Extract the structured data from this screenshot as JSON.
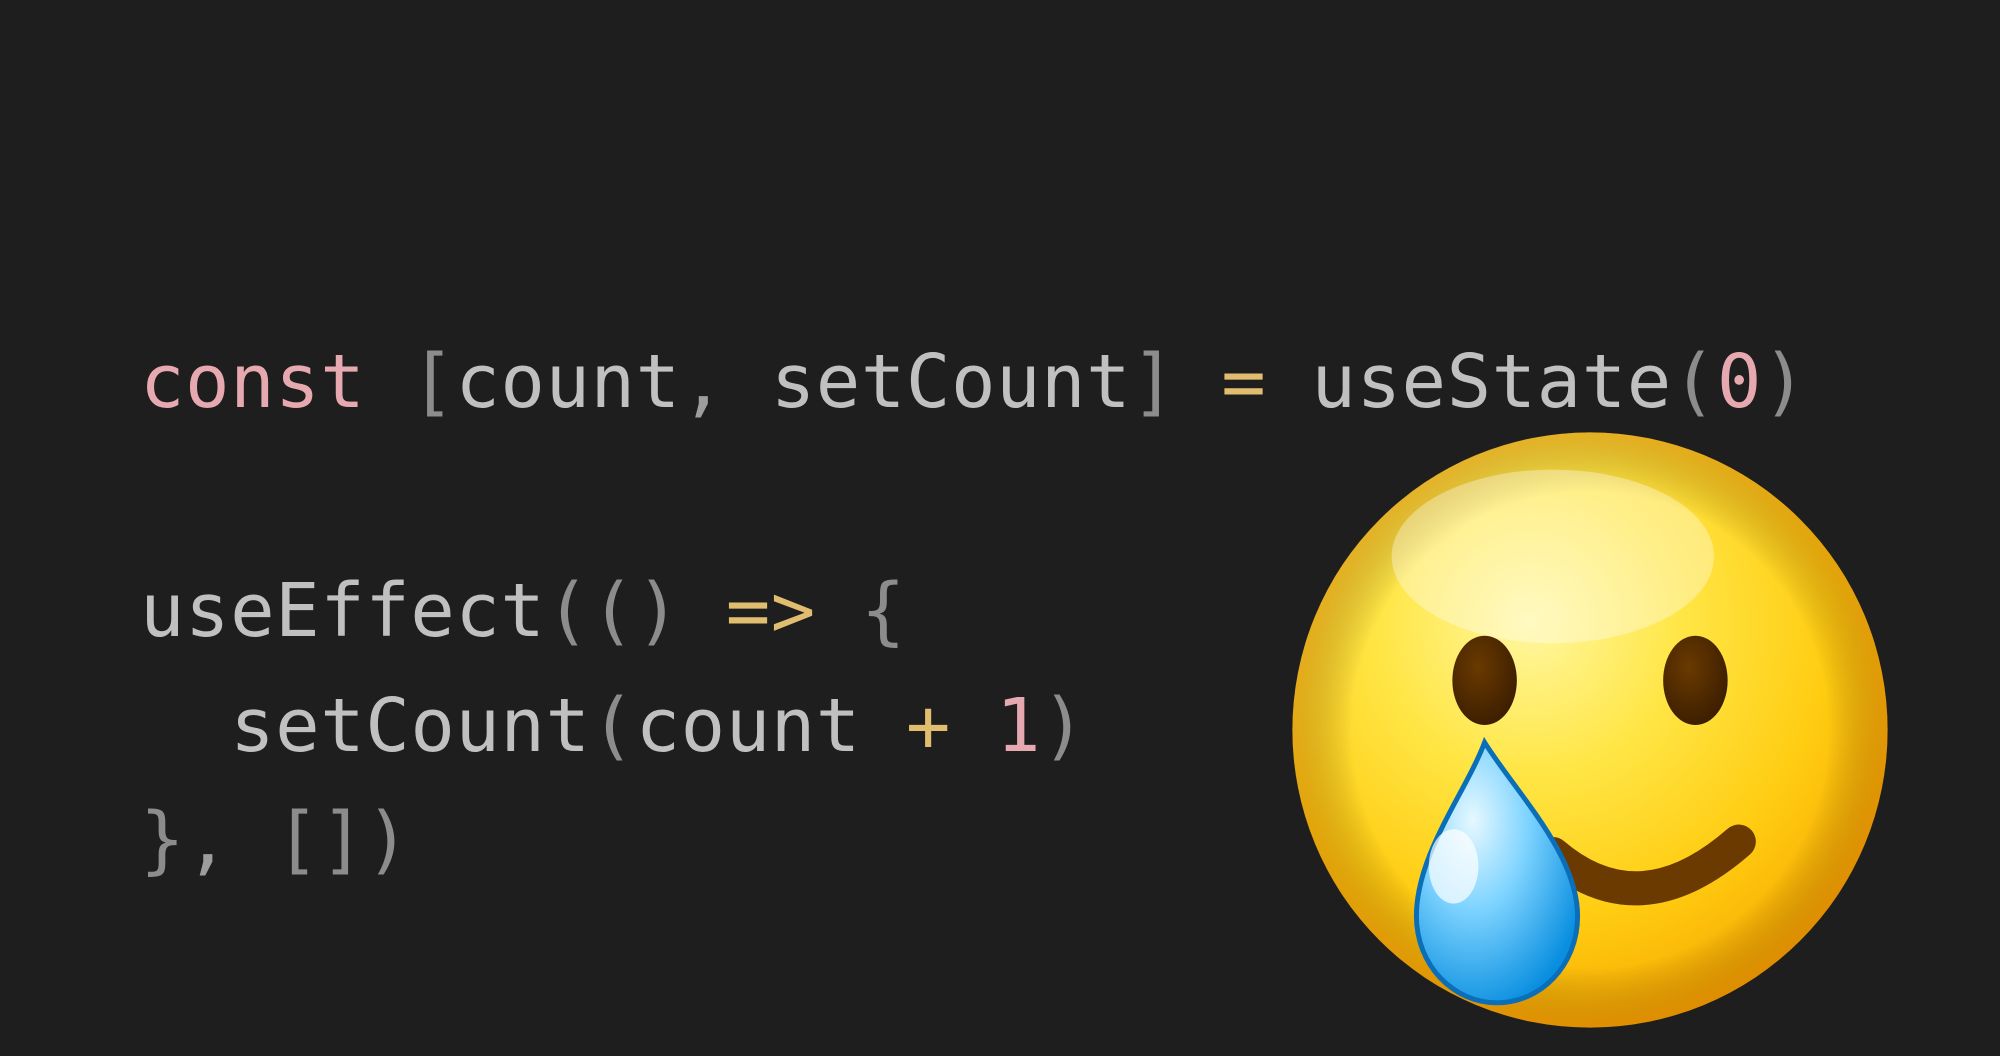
{
  "colors": {
    "bg": "#1e1e1e",
    "keyword": "#e6a9b0",
    "bracket": "#8c8c8c",
    "ident": "#c0c0c0",
    "punct": "#9d9d9d",
    "op": "#e1bd6f",
    "number": "#e6a9b0"
  },
  "emoji": {
    "name": "smiling-face-with-tear",
    "codepoint": "1F972"
  },
  "code": {
    "line1": {
      "const": "const ",
      "lbracket": "[",
      "count": "count",
      "comma": ", ",
      "setCount": "setCount",
      "rbracket": "]",
      "space1": " ",
      "eq": "=",
      "space2": " ",
      "useState": "useState",
      "lparen": "(",
      "zero": "0",
      "rparen": ")"
    },
    "blank": "",
    "line3": {
      "useEffect": "useEffect",
      "lparen": "(",
      "lparen2": "(",
      "rparen2": ")",
      "space1": " ",
      "arrow": "=>",
      "space2": " ",
      "lbrace": "{"
    },
    "line4": {
      "indent": "  ",
      "setCount": "setCount",
      "lparen": "(",
      "count": "count",
      "space1": " ",
      "plus": "+",
      "space2": " ",
      "one": "1",
      "rparen": ")"
    },
    "line5": {
      "rbrace": "}",
      "comma": ", ",
      "lbracket": "[",
      "rbracket": "]",
      "rparen": ")"
    }
  }
}
